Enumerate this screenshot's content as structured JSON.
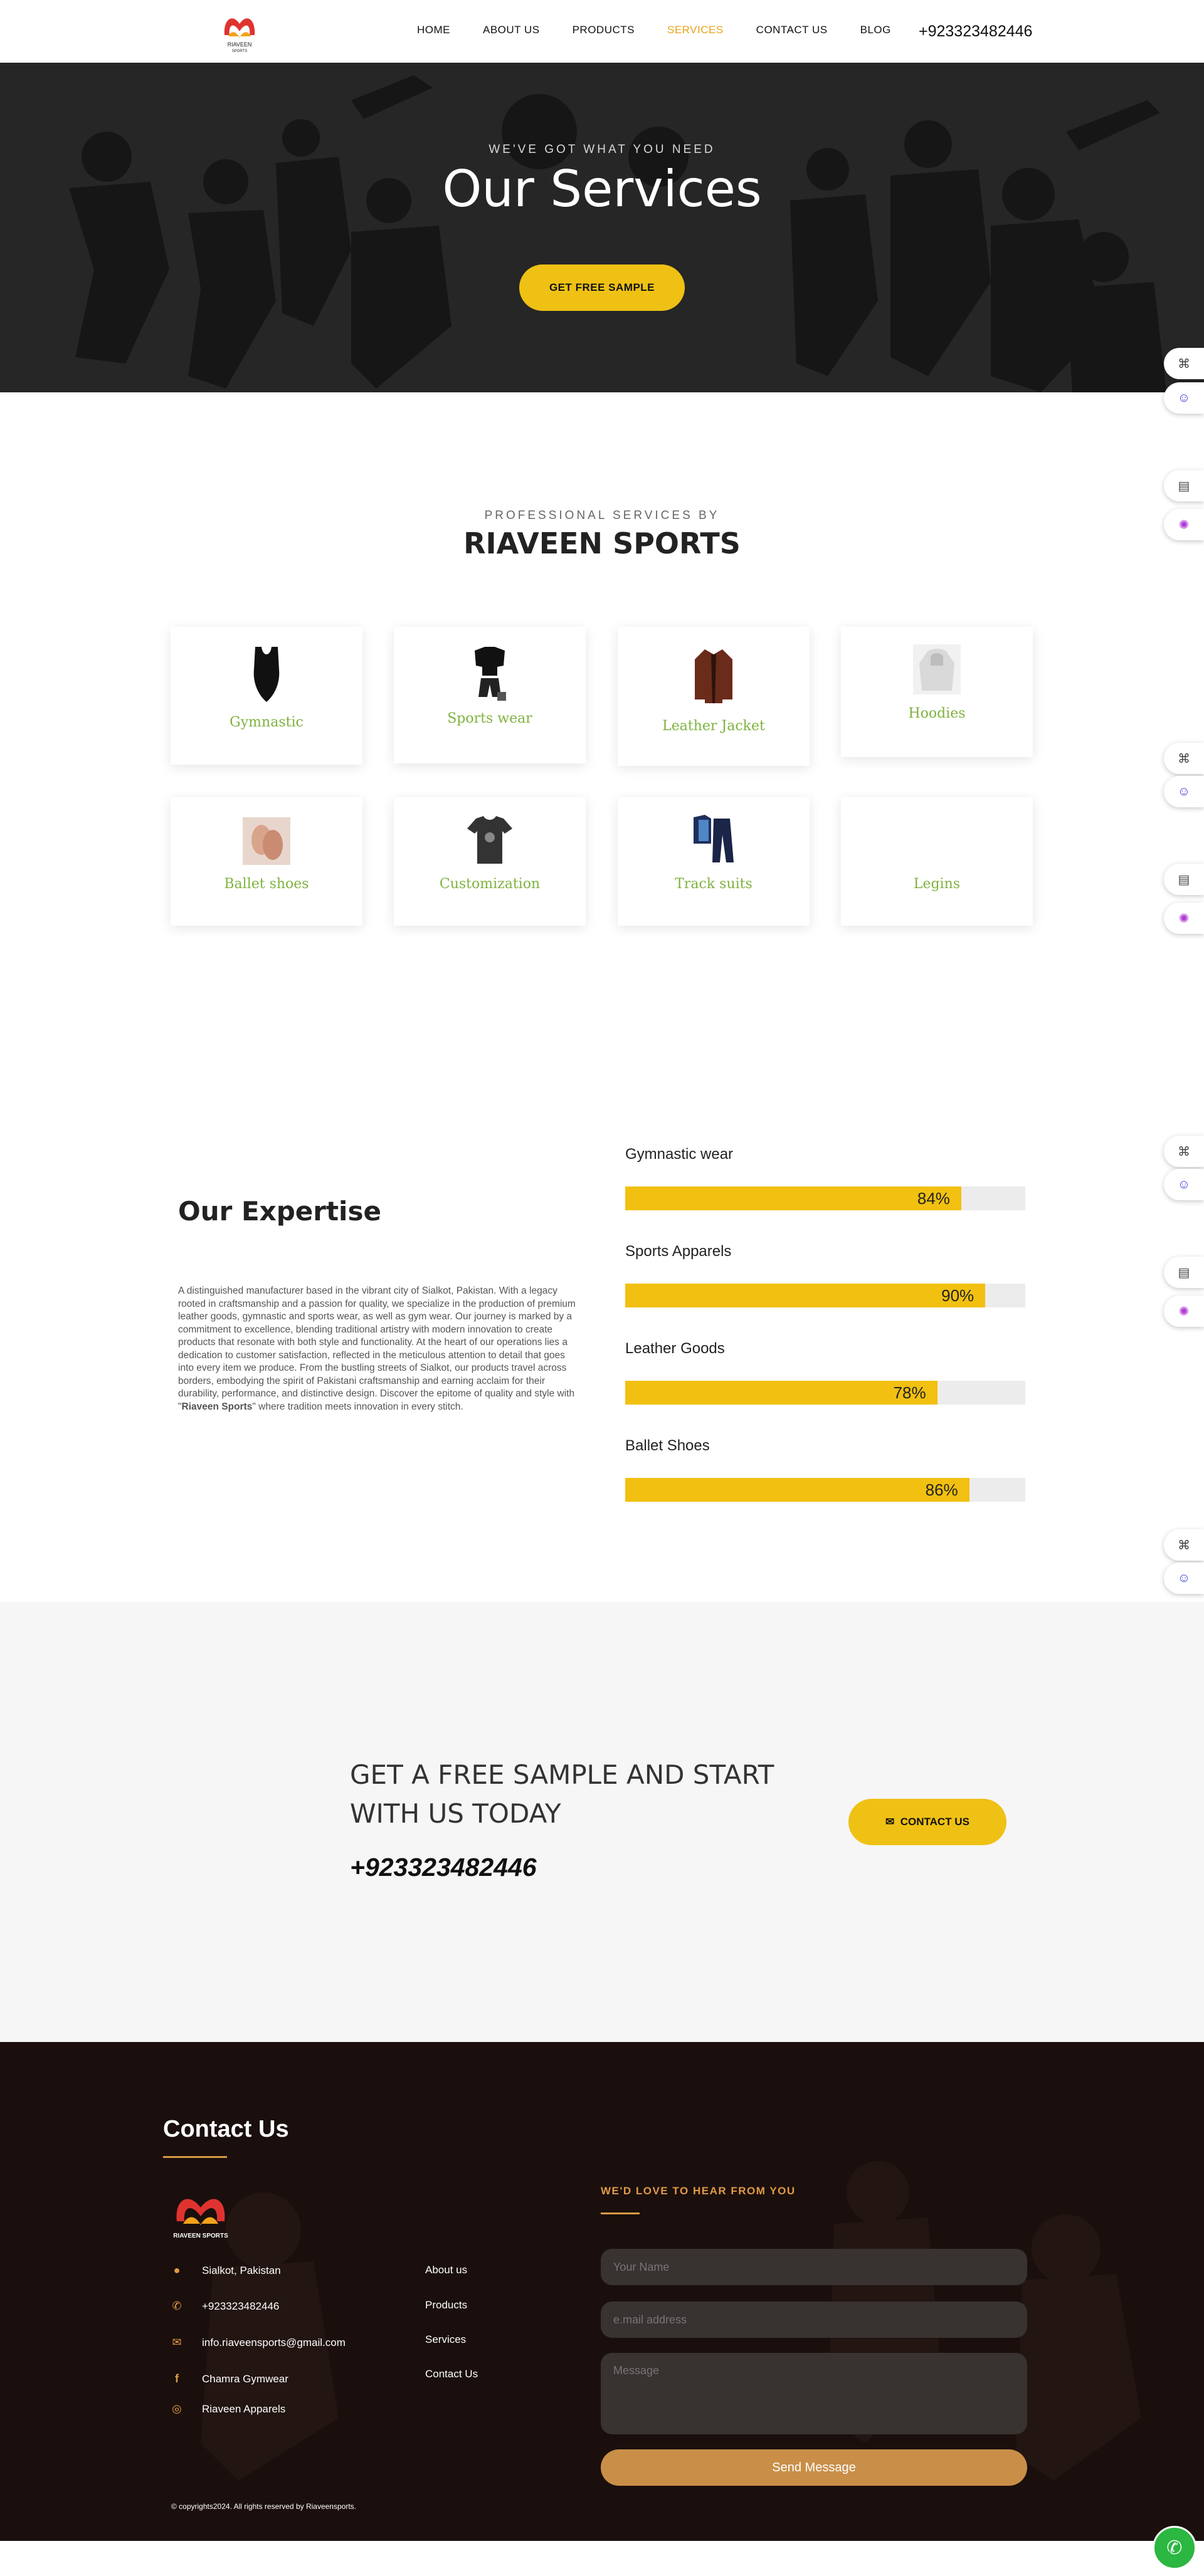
{
  "header": {
    "logo_text": "RIAVEEN SPORTS",
    "nav": [
      "HOME",
      "ABOUT US",
      "PRODUCTS",
      "SERVICES",
      "CONTACT US",
      "BLOG"
    ],
    "active_nav": "SERVICES",
    "phone": "+923323482446"
  },
  "hero": {
    "kicker": "WE'VE GOT WHAT YOU NEED",
    "title": "Our Services",
    "button": "GET FREE SAMPLE"
  },
  "services": {
    "kicker": "PROFESSIONAL SERVICES BY",
    "title": "RIAVEEN SPORTS",
    "items": [
      {
        "label": "Gymnastic",
        "icon": "leotard-icon"
      },
      {
        "label": "Sports wear",
        "icon": "sportswear-icon"
      },
      {
        "label": "Leather Jacket",
        "icon": "leather-jacket-icon"
      },
      {
        "label": "Hoodies",
        "icon": "hoodie-icon"
      },
      {
        "label": "Ballet shoes",
        "icon": "ballet-shoes-icon"
      },
      {
        "label": "Customization",
        "icon": "tshirt-icon"
      },
      {
        "label": "Track suits",
        "icon": "tracksuit-icon"
      },
      {
        "label": "Legins",
        "icon": ""
      }
    ]
  },
  "expertise": {
    "title": "Our Expertise",
    "text_before": "A distinguished manufacturer based in the vibrant city of Sialkot, Pakistan. With a legacy rooted in craftsmanship and a passion for quality, we specialize in the production of premium leather goods, gymnastic and sports wear, as well as gym wear. Our journey is marked by a commitment to excellence, blending traditional artistry with modern innovation to create products that resonate with both style and functionality. At the heart of our operations lies a dedication to customer satisfaction, reflected in the meticulous attention to detail that goes into every item we produce. From the bustling streets of Sialkot, our products travel across borders, embodying the spirit of Pakistani craftsmanship and earning acclaim for their durability, performance, and distinctive design. Discover the epitome of quality and style with \"",
    "text_bold": "Riaveen Sports",
    "text_after": "\" where tradition meets innovation in every stitch.",
    "bars": [
      {
        "label": "Gymnastic wear",
        "value": 84,
        "display": "84%"
      },
      {
        "label": "Sports Apparels",
        "value": 90,
        "display": "90%"
      },
      {
        "label": "Leather Goods",
        "value": 78,
        "display": "78%"
      },
      {
        "label": "Ballet Shoes",
        "value": 86,
        "display": "86%"
      }
    ]
  },
  "cta": {
    "line1": "GET A FREE SAMPLE AND START",
    "line2": "WITH US TODAY",
    "phone": "+923323482446",
    "button": "CONTACT US"
  },
  "footer": {
    "title": "Contact Us",
    "logo_text": "RIAVEEN SPORTS",
    "contacts": [
      {
        "icon": "location-pin-icon",
        "text": "Sialkot, Pakistan"
      },
      {
        "icon": "phone-icon",
        "text": "+923323482446"
      },
      {
        "icon": "envelope-icon",
        "text": "info.riaveensports@gmail.com"
      },
      {
        "icon": "facebook-icon",
        "text": "Chamra Gymwear"
      },
      {
        "icon": "instagram-icon",
        "text": "Riaveen Apparels"
      }
    ],
    "links": [
      "About us",
      "Products",
      "Services",
      "Contact Us"
    ],
    "form_kicker": "WE'D LOVE TO HEAR FROM YOU",
    "name_placeholder": "Your Name",
    "email_placeholder": "e.mail address",
    "message_placeholder": "Message",
    "send": "Send Message",
    "copyright": "© copyrights2024.  All rights reserved by Riaveensports."
  },
  "colors": {
    "accent_yellow": "#efc115",
    "active_nav": "#e8a215",
    "card_label_green": "#7fb23f",
    "footer_bg": "#1a0f0d",
    "footer_accent": "#d79a45"
  }
}
